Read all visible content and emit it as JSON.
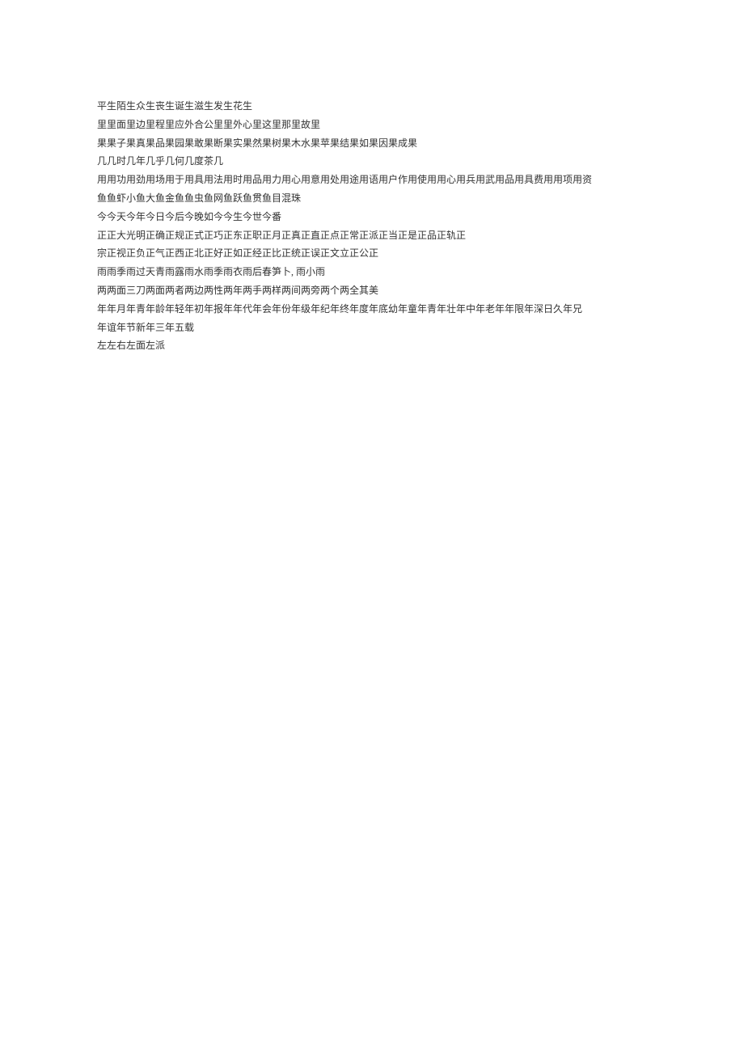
{
  "lines": [
    "平生陌生众生丧生诞生滋生发生花生",
    "里里面里边里程里应外合公里里外心里这里那里故里",
    "果果子果真果品果园果敢果断果实果然果树果木水果苹果结果如果因果成果",
    "几几时几年几乎几何几度茶几",
    "用用功用劲用场用于用具用法用时用品用力用心用意用处用途用语用户作用使用用心用兵用武用品用具费用用项用资",
    "鱼鱼虾小鱼大鱼金鱼鱼虫鱼网鱼跃鱼贯鱼目混珠",
    "今今天今年今日今后今晚如今今生今世今番",
    "正正大光明正确正规正式正巧正东正职正月正真正直正点正常正派正当正是正品正轨正",
    "宗正视正负正气正西正北正好正如正经正比正统正误正文立正公正",
    "雨雨季雨过天青雨露雨水雨季雨衣雨后春笋卜, 雨小雨",
    "两两面三刀两面两者两边两性两年两手两样两间两旁两个两全其美",
    "年年月年青年龄年轻年初年报年年代年会年份年级年纪年终年度年底幼年童年青年壮年中年老年年限年深日久年兄",
    "年谊年节新年三年五载",
    "左左右左面左派"
  ]
}
